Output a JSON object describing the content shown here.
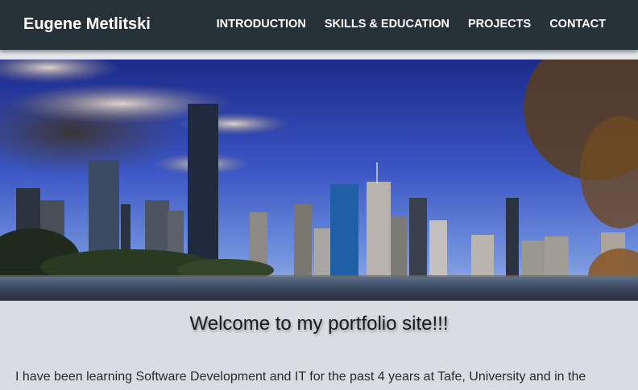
{
  "nav": {
    "brand": "Eugene Metlitski",
    "links": [
      {
        "label": "INTRODUCTION"
      },
      {
        "label": "SKILLS & EDUCATION"
      },
      {
        "label": "PROJECTS"
      },
      {
        "label": "CONTACT"
      }
    ]
  },
  "hero": {
    "image": "brisbane-city-skyline-river-photo"
  },
  "main": {
    "welcome_heading": "Welcome to my portfolio site!!!",
    "intro_text": "I have been learning Software Development and IT for the past 4 years at Tafe, University and in the"
  },
  "colors": {
    "navbar_bg": "#263238",
    "page_bg": "#d9dde3",
    "nav_text": "#ffffff"
  }
}
